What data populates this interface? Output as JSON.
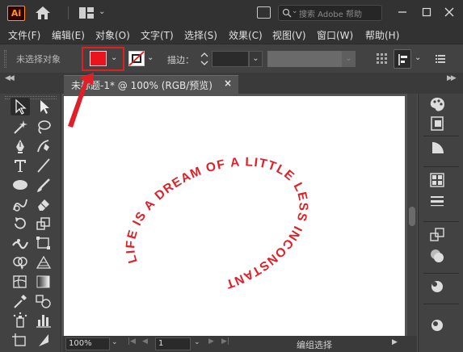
{
  "app": {
    "logo_text": "Ai",
    "search_placeholder": "搜索 Adobe 帮助"
  },
  "menu": [
    {
      "label": "文件(F)"
    },
    {
      "label": "编辑(E)"
    },
    {
      "label": "对象(O)"
    },
    {
      "label": "文字(T)"
    },
    {
      "label": "选择(S)"
    },
    {
      "label": "效果(C)"
    },
    {
      "label": "视图(V)"
    },
    {
      "label": "窗口(W)"
    },
    {
      "label": "帮助(H)"
    }
  ],
  "control": {
    "selection_status": "未选择对象",
    "fill_color": "#e8151e",
    "stroke_label": "描边："
  },
  "document": {
    "tab_title": "未标题-1* @ 100% (RGB/预览)",
    "close_symbol": "×",
    "ring_text": "LIFE IS A DREAM OF A LITTLE LESS INCONSTANT",
    "ring_color": "#e02028"
  },
  "status": {
    "zoom": "100%",
    "page": "1",
    "status_text": "编组选择"
  },
  "colors": {
    "highlight": "#e02020",
    "app_dark": "#323232",
    "panel": "#424242"
  }
}
